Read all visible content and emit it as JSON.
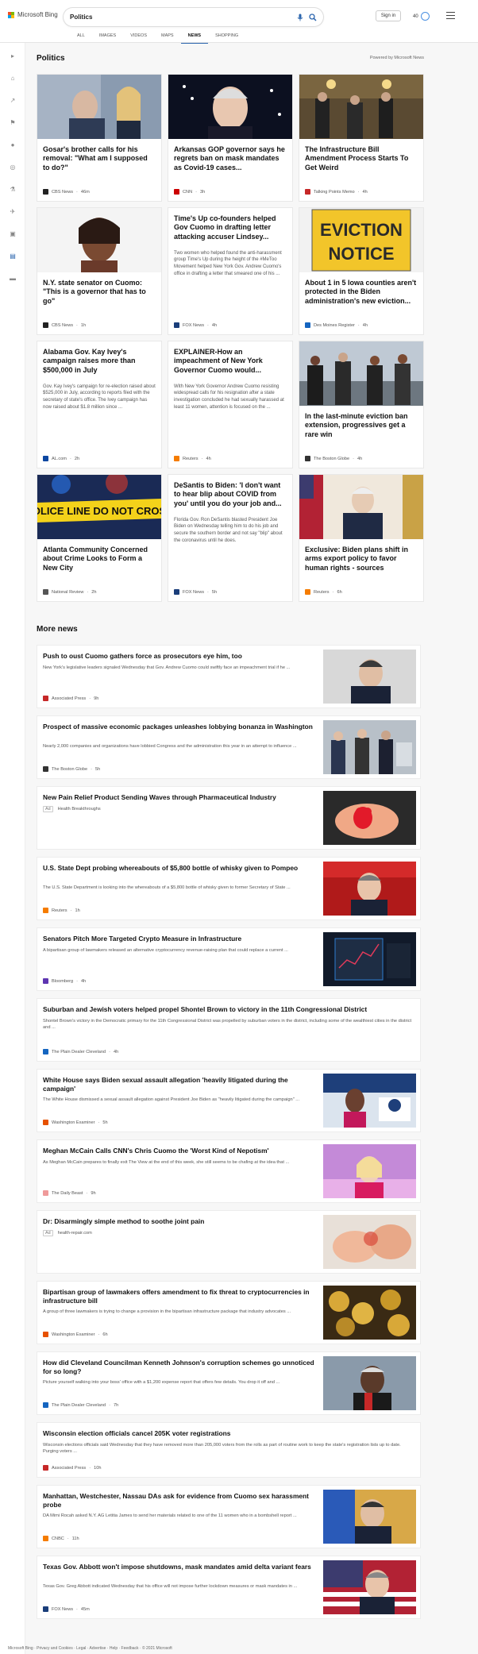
{
  "brand": {
    "name": "Microsoft Bing",
    "colors": [
      "#f25022",
      "#7fba00",
      "#00a4ef",
      "#ffb900"
    ]
  },
  "search": {
    "query": "Politics"
  },
  "tabs": [
    {
      "label": "ALL"
    },
    {
      "label": "IMAGES"
    },
    {
      "label": "VIDEOS"
    },
    {
      "label": "MAPS"
    },
    {
      "label": "NEWS",
      "active": true
    },
    {
      "label": "SHOPPING"
    }
  ],
  "header": {
    "signin": "Sign in",
    "points": "40"
  },
  "section": {
    "title": "Politics",
    "powered": "Powered by Microsoft News"
  },
  "cards": [
    {
      "title": "Gosar's brother calls for his removal: \"What am I supposed to do?\"",
      "snippet": "",
      "source": "CBS News",
      "time": "46m",
      "logo_color": "#222"
    },
    {
      "title": "Arkansas GOP governor says he regrets ban on mask mandates as Covid-19 cases...",
      "snippet": "",
      "source": "CNN",
      "time": "3h",
      "logo_color": "#cc0000"
    },
    {
      "title": "The Infrastructure Bill Amendment Process Starts To Get Weird",
      "snippet": "",
      "source": "Talking Points Memo",
      "time": "4h",
      "logo_color": "#c62828"
    },
    {
      "title": "N.Y. state senator on Cuomo: \"This is a governor that has to go\"",
      "snippet": "",
      "source": "CBS News",
      "time": "1h",
      "logo_color": "#222"
    },
    {
      "title": "Time's Up co-founders helped Gov Cuomo in drafting letter attacking accuser Lindsey...",
      "snippet": "Two women who helped found the anti-harassment group Time's Up during the height of the #MeToo Movement helped New York Gov. Andrew Cuomo's office in drafting a letter that smeared one of his ...",
      "source": "FOX News",
      "time": "4h",
      "logo_color": "#1a3e7a"
    },
    {
      "title": "About 1 in 5 Iowa counties aren't protected in the Biden administration's new eviction...",
      "snippet": "",
      "source": "Des Moines Register",
      "time": "4h",
      "logo_color": "#1565c0"
    },
    {
      "title": "Alabama Gov. Kay Ivey's campaign raises more than $500,000 in July",
      "snippet": "Gov. Kay Ivey's campaign for re-election raised about $525,000 in July, according to reports filed with the secretary of state's office. The Ivey campaign has now raised about $1.8 million since ...",
      "source": "AL.com",
      "time": "2h",
      "logo_color": "#0d47a1"
    },
    {
      "title": "EXPLAINER-How an impeachment of New York Governor Cuomo would...",
      "snippet": "With New York Governor Andrew Cuomo resisting widespread calls for his resignation after a state investigation concluded he had sexually harassed at least 11 women, attention is focused on the ...",
      "source": "Reuters",
      "time": "4h",
      "logo_color": "#f57c00"
    },
    {
      "title": "In the last-minute eviction ban extension, progressives get a rare win",
      "snippet": "",
      "source": "The Boston Globe",
      "time": "4h",
      "logo_color": "#333"
    },
    {
      "title": "Atlanta Community Concerned about Crime Looks to Form a New City",
      "snippet": "",
      "source": "National Review",
      "time": "2h",
      "logo_color": "#555"
    },
    {
      "title": "DeSantis to Biden: 'I don't want to hear blip about COVID from you' until you do your job and...",
      "snippet": "Florida Gov. Ron DeSantis blasted President Joe Biden on Wednesday telling him to do his job and secure the southern border and not say \"blip\" about the coronavirus until he does.",
      "source": "FOX News",
      "time": "5h",
      "logo_color": "#1a3e7a"
    },
    {
      "title": "Exclusive: Biden plans shift in arms export policy to favor human rights - sources",
      "snippet": "",
      "source": "Reuters",
      "time": "6h",
      "logo_color": "#f57c00"
    }
  ],
  "more": {
    "title": "More news",
    "items": [
      {
        "title": "Push to oust Cuomo gathers force as prosecutors eye him, too",
        "snippet": "New York's legislative leaders signaled Wednesday that Gov. Andrew Cuomo could swiftly face an impeachment trial if he ...",
        "source": "Associated Press",
        "time": "9h",
        "ad": false,
        "logo_color": "#c62828"
      },
      {
        "title": "Prospect of massive economic packages unleashes lobbying bonanza in Washington",
        "snippet": "Nearly 2,000 companies and organizations have lobbied Congress and the administration this year in an attempt to influence ...",
        "source": "The Boston Globe",
        "time": "5h",
        "ad": false,
        "logo_color": "#333"
      },
      {
        "title": "New Pain Relief Product Sending Waves through Pharmaceutical Industry",
        "snippet": "",
        "source": "Health Breakthroughs",
        "time": "",
        "ad": true,
        "logo_color": ""
      },
      {
        "title": "U.S. State Dept probing whereabouts of $5,800 bottle of whisky given to Pompeo",
        "snippet": "The U.S. State Department is looking into the whereabouts of a $5,800 bottle of whisky given to former Secretary of State ...",
        "source": "Reuters",
        "time": "1h",
        "ad": false,
        "logo_color": "#f57c00"
      },
      {
        "title": "Senators Pitch More Targeted Crypto Measure in Infrastructure",
        "snippet": "A bipartisan group of lawmakers released an alternative cryptocurrency revenue-raising plan that could replace a current ...",
        "source": "Bloomberg",
        "time": "4h",
        "ad": false,
        "logo_color": "#5e35b1"
      },
      {
        "title": "Suburban and Jewish voters helped propel Shontel Brown to victory in the 11th Congressional District",
        "snippet": "Shontel Brown's victory in the Democratic primary for the 11th Congressional District was propelled by suburban voters in the district, including some of the wealthiest cities in the district and ...",
        "source": "The Plain Dealer Cleveland",
        "time": "4h",
        "ad": false,
        "logo_color": "#1565c0"
      },
      {
        "title": "White House says Biden sexual assault allegation 'heavily litigated during the campaign'",
        "snippet": "The White House dismissed a sexual assault allegation against President Joe Biden as \"heavily litigated during the campaign\" ...",
        "source": "Washington Examiner",
        "time": "5h",
        "ad": false,
        "logo_color": "#e65100"
      },
      {
        "title": "Meghan McCain Calls CNN's Chris Cuomo the 'Worst Kind of Nepotism'",
        "snippet": "As Meghan McCain prepares to finally exit The View at the end of this week, she still seems to be chafing at the idea that ...",
        "source": "The Daily Beast",
        "time": "9h",
        "ad": false,
        "logo_color": "#ef9a9a"
      },
      {
        "title": "Dr: Disarmingly simple method to soothe joint pain",
        "snippet": "",
        "source": "health-repair.com",
        "time": "",
        "ad": true,
        "logo_color": ""
      },
      {
        "title": "Bipartisan group of lawmakers offers amendment to fix threat to cryptocurrencies in infrastructure bill",
        "snippet": "A group of three lawmakers is trying to change a provision in the bipartisan infrastructure package that industry advocates ...",
        "source": "Washington Examiner",
        "time": "6h",
        "ad": false,
        "logo_color": "#e65100"
      },
      {
        "title": "How did Cleveland Councilman Kenneth Johnson's corruption schemes go unnoticed for so long?",
        "snippet": "Picture yourself walking into your boss' office with a $1,200 expense report that offers few details. You drop it off and ...",
        "source": "The Plain Dealer Cleveland",
        "time": "7h",
        "ad": false,
        "logo_color": "#1565c0"
      },
      {
        "title": "Wisconsin election officials cancel 205K voter registrations",
        "snippet": "Wisconsin elections officials said Wednesday that they have removed more than 205,000 voters from the rolls as part of routine work to keep the state's registration lists up to date. Purging voters ...",
        "source": "Associated Press",
        "time": "10h",
        "ad": false,
        "logo_color": "#c62828"
      },
      {
        "title": "Manhattan, Westchester, Nassau DAs ask for evidence from Cuomo sex harassment probe",
        "snippet": "DA Mimi Rocah asked N.Y. AG Letitia James to send her materials related to one of the 11 women who in a bombshell report ...",
        "source": "CNBC",
        "time": "11h",
        "ad": false,
        "logo_color": "#f57c00"
      },
      {
        "title": "Texas Gov. Abbott won't impose shutdowns, mask mandates amid delta variant fears",
        "snippet": "Texas Gov. Greg Abbott indicated Wednesday that his office will not impose further lockdown measures or mask mandates in ...",
        "source": "FOX News",
        "time": "45m",
        "ad": false,
        "logo_color": "#1a3e7a"
      }
    ]
  },
  "footer": {
    "text": "Microsoft Bing  ·  Privacy and Cookies  ·  Legal  ·  Advertise  ·  Help  ·  Feedback  ·  © 2021 Microsoft"
  }
}
